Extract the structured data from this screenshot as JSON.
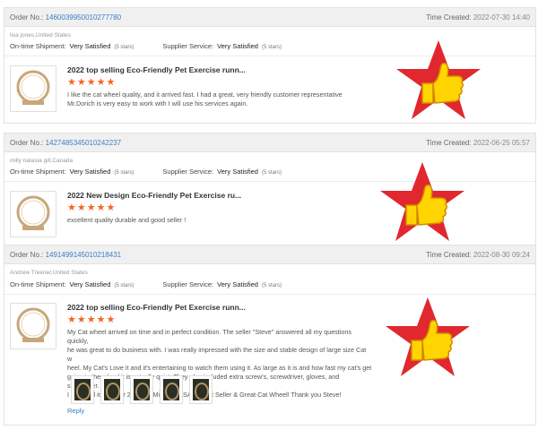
{
  "colors": {
    "accent": "#f26522",
    "link": "#3a7fc4",
    "star_badge": "#e0282e",
    "thumb_badge": "#ffd400"
  },
  "labels": {
    "order_no": "Order No.:",
    "time_created": "Time Created:",
    "on_time_shipment": "On-time Shipment:",
    "supplier_service": "Supplier Service:",
    "reply": "Reply"
  },
  "reviews": [
    {
      "order_no": "1460039950010277780",
      "time_created": "2022-07-30 14:40",
      "buyer": "lisa jones,United States",
      "shipment_rating": "Very Satisfied",
      "shipment_stars": "(5 stars)",
      "service_rating": "Very Satisfied",
      "service_stars": "(5 stars)",
      "product_title": "2022 top selling Eco-Friendly Pet Exercise runn...",
      "stars": "★★★★★",
      "text_lines": [
        "I like the cat wheel quality, and it arrived fast. I had a great, very friendly customer representative",
        " Mr.Dorich is very easy to work with I will use his services again."
      ]
    },
    {
      "order_no": "1427485345010242237",
      "time_created": "2022-06-25 05:57",
      "buyer": "milly natasia gill,Canada",
      "shipment_rating": "Very Satisfied",
      "shipment_stars": "(5 stars)",
      "service_rating": "Very Satisfied",
      "service_stars": "(5 stars)",
      "product_title": "2022 New Design Eco-Friendly Pet Exercise ru...",
      "stars": "★★★★★",
      "text_lines": [
        "excellent quality durable and good seller !"
      ]
    },
    {
      "order_no": "1491499145010218431",
      "time_created": "2022-08-30 09:24",
      "buyer": "Andrew Treener,United States",
      "shipment_rating": "Very Satisfied",
      "shipment_stars": "(5 stars)",
      "service_rating": "Very Satisfied",
      "service_stars": "(5 stars)",
      "product_title": "2022 top selling Eco-Friendly Pet Exercise runn...",
      "stars": "★★★★★",
      "text_lines": [
        "My Cat wheel arrived on time and in perfect condition. The seller \"Steve\" answered all my questions quickly,",
        "he was great to do business with. I was really impressed with the size and stable design of large size Cat w",
        "heel. My Cat's Love it and it's entertaining to watch them using it. As large as it is and how fast my cat's get",
        "going in the wheel it is actually quiet. They also included extra screw's, screwdriver, gloves, and sandpaper.",
        "I received it in under 2 weeks(Midwest USA). Great Seller & Great Cat Wheel! Thank you Steve!"
      ]
    }
  ]
}
